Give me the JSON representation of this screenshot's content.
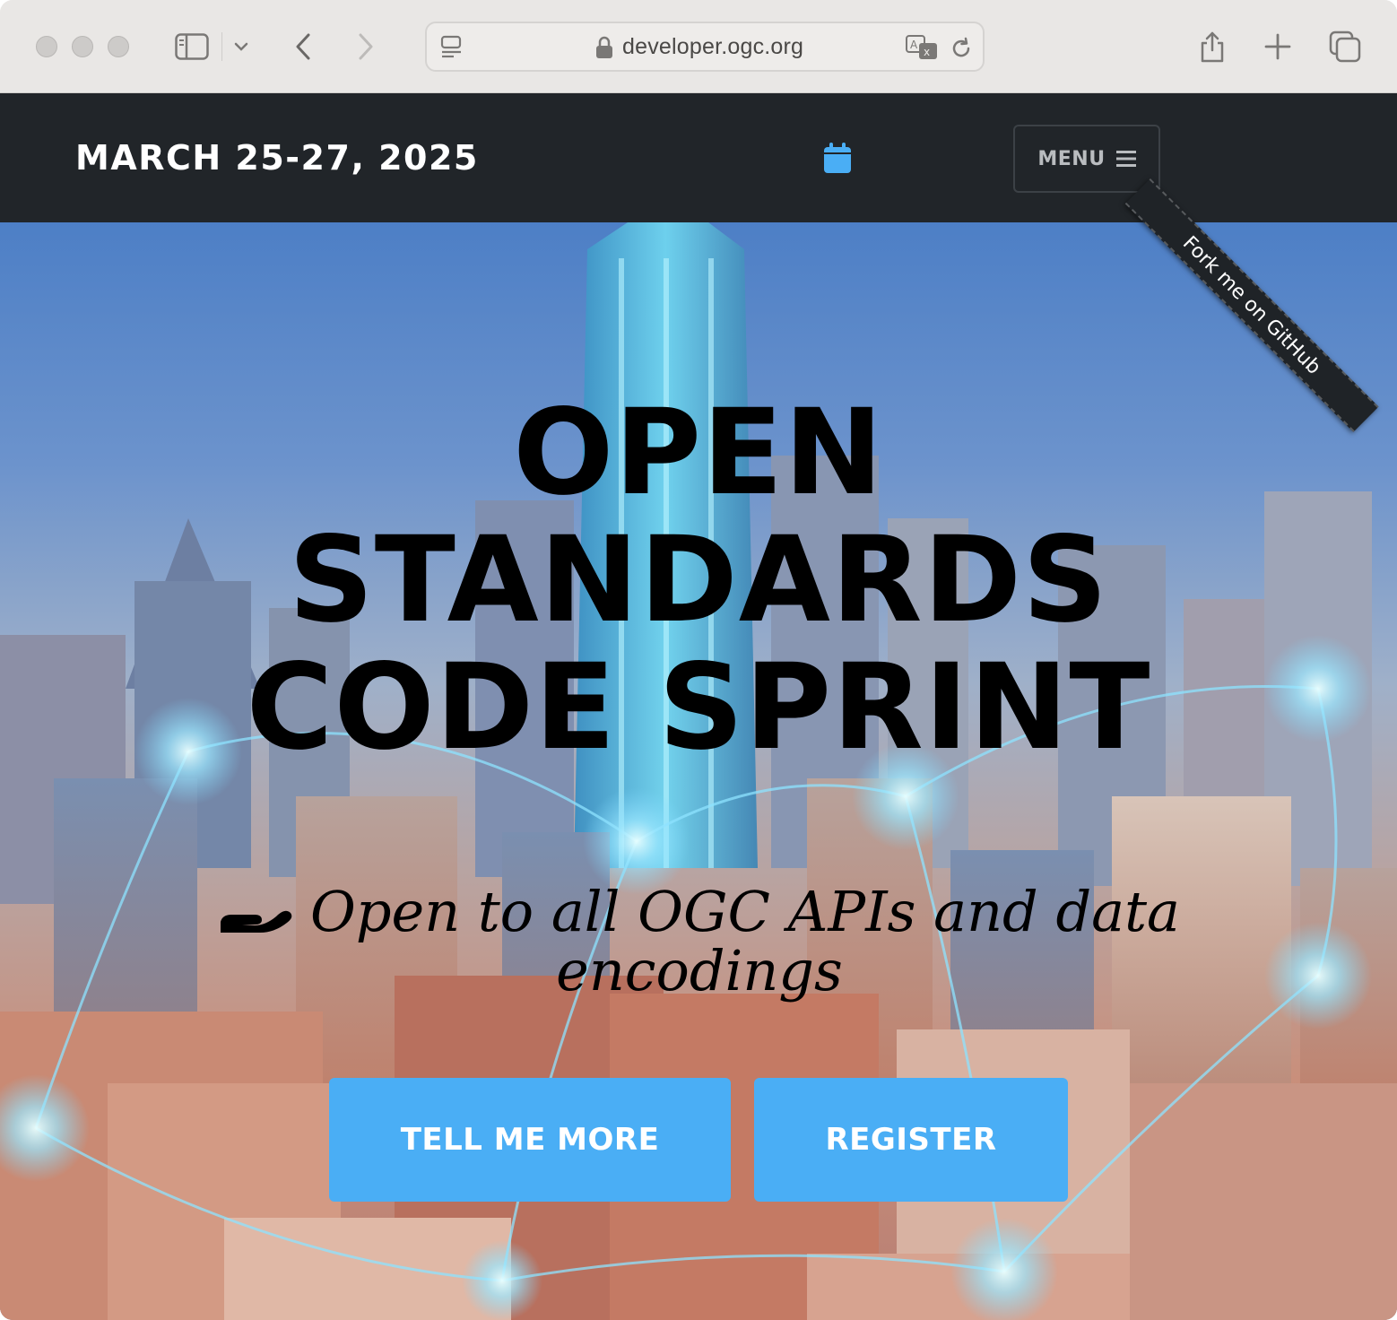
{
  "browser": {
    "url": "developer.ogc.org"
  },
  "navbar": {
    "brand": "MARCH 25-27, 2025",
    "calendar_icon": "calendar-icon",
    "menu_label": "MENU",
    "menu_icon": "hamburger-icon"
  },
  "ribbon": {
    "label": "Fork me on GitHub"
  },
  "hero": {
    "headline": [
      "OPEN",
      "STANDARDS",
      "CODE SPRINT"
    ],
    "subline": "Open to all OGC APIs and data encodings",
    "subline_icon": "hand-holding-icon",
    "buttons": {
      "more": "TELL ME MORE",
      "register": "REGISTER"
    }
  },
  "colors": {
    "navbar_bg": "#212529",
    "accent": "#4aaef5",
    "calendar_icon": "#4aaef5"
  }
}
